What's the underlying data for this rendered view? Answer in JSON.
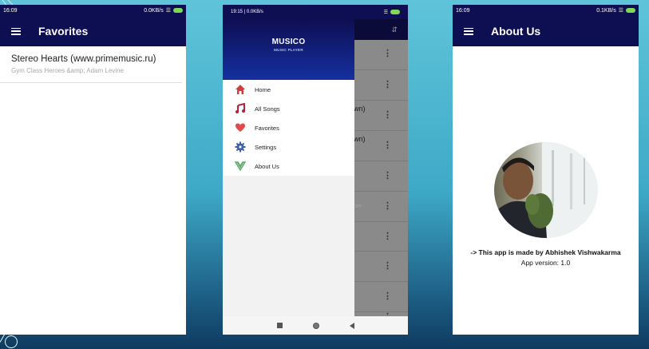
{
  "screen1": {
    "status_time": "16:09",
    "status_right": "0.0KB/s",
    "title": "Favorites",
    "favorites": [
      {
        "title": "Stereo Hearts (www.primemusic.ru)",
        "artist": "Gym Class Heroes &amp; Adam Levine"
      }
    ]
  },
  "screen2": {
    "status_left": "19:15 | 0.0KB/s",
    "drawer_title": "MUSICO",
    "drawer_subtitle": "MUSIC PLAYER",
    "menu": [
      {
        "label": "Home",
        "icon": "home-icon",
        "color": "#d63b3b"
      },
      {
        "label": "All Songs",
        "icon": "music-note-icon",
        "color": "#b4233a"
      },
      {
        "label": "Favorites",
        "icon": "heart-icon",
        "color": "#e04a4a"
      },
      {
        "label": "Settings",
        "icon": "gear-icon",
        "color": "#3f5fa8"
      },
      {
        "label": "About Us",
        "icon": "shield-logo-icon",
        "color": "#5aaa6a"
      }
    ],
    "background_fragments": [
      "wn)",
      "wn)",
      "om"
    ]
  },
  "screen3": {
    "status_time": "16:09",
    "status_right": "0.1KB/s",
    "title": "About Us",
    "made_by": "-> This app is made by Abhishek Vishwakarma",
    "version": "App version: 1.0"
  },
  "colors": {
    "appbar": "#0e0e52",
    "accent_red": "#d63b3b"
  }
}
